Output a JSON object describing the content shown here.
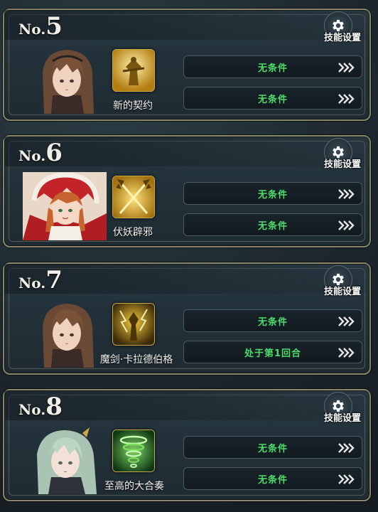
{
  "gear_label": "技能设置",
  "cards": [
    {
      "prefix": "No.",
      "number": "5",
      "skill_name": "新的契约",
      "conditions": [
        "无条件",
        "无条件"
      ],
      "icon": "golden-warrior-skill-icon"
    },
    {
      "prefix": "No.",
      "number": "6",
      "skill_name": "伏妖辟邪",
      "conditions": [
        "无条件",
        "无条件"
      ],
      "icon": "crossed-halberds-skill-icon"
    },
    {
      "prefix": "No.",
      "number": "7",
      "skill_name": "魔剑·卡拉德伯格",
      "conditions": [
        "无条件",
        "处于第1回合"
      ],
      "icon": "lightning-swordsman-skill-icon"
    },
    {
      "prefix": "No.",
      "number": "8",
      "skill_name": "至高的大合奏",
      "conditions": [
        "无条件",
        "无条件"
      ],
      "icon": "green-tornado-skill-icon"
    }
  ],
  "colors": {
    "condition_text": "#4fdc6a",
    "frame": "#8a8668",
    "panel": "#23323a"
  }
}
